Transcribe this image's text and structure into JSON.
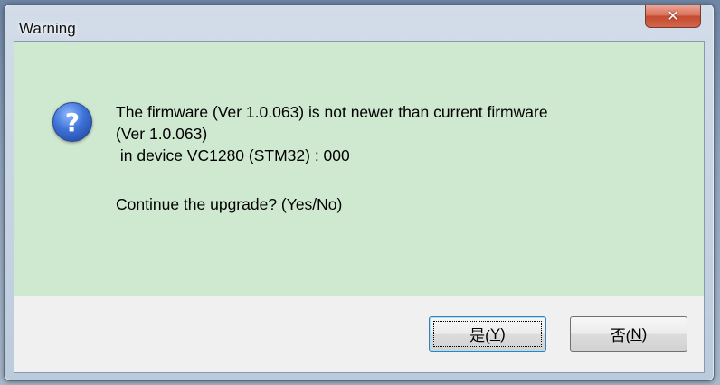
{
  "dialog": {
    "title": "Warning",
    "close_glyph": "✕",
    "icon": "question-icon",
    "icon_glyph": "?",
    "message_lines": [
      "The firmware (Ver 1.0.063) is not newer than current firmware",
      "(Ver 1.0.063)",
      " in device VC1280 (STM32) : 000"
    ],
    "question": "Continue the upgrade? (Yes/No)",
    "buttons": {
      "yes": {
        "label": "是(",
        "mnemonic": "Y",
        "suffix": ")"
      },
      "no": {
        "label": "否(",
        "mnemonic": "N",
        "suffix": ")"
      }
    },
    "colors": {
      "message_bg": "#cfe8d0",
      "footer_bg": "#f0f0f0",
      "close_bg": "#c44a30"
    }
  }
}
